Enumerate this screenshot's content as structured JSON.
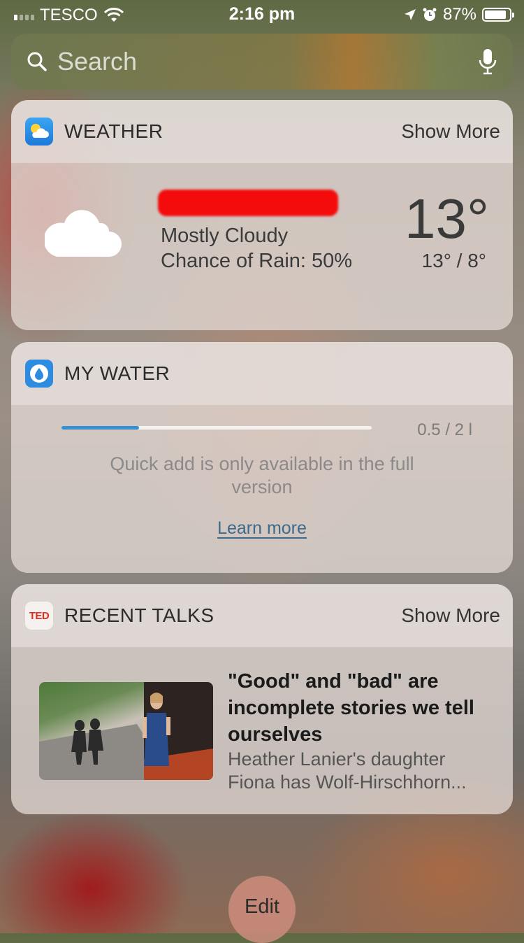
{
  "status_bar": {
    "carrier": "TESCO",
    "time": "2:16 pm",
    "battery": "87%",
    "battery_level": 0.87,
    "icons": [
      "signal-icon",
      "wifi-icon",
      "location-icon",
      "alarm-icon",
      "battery-icon"
    ]
  },
  "search": {
    "placeholder": "Search",
    "icons": [
      "search-icon",
      "microphone-icon"
    ]
  },
  "weather": {
    "title": "WEATHER",
    "show_more": "Show More",
    "condition": "Mostly Cloudy",
    "rain": "Chance of Rain: 50%",
    "temperature": "13°",
    "range": "13° / 8°",
    "icon": "cloud-icon"
  },
  "water": {
    "title": "MY WATER",
    "amount": "0.5 / 2 l",
    "progress": 0.25,
    "quick_add": "Quick add is only available in the full version",
    "learn_more": "Learn more",
    "accent": "#3a8fd0"
  },
  "talks": {
    "title": "RECENT TALKS",
    "show_more": "Show More",
    "talk_title": "\"Good\" and \"bad\" are incomplete stories we tell ourselves",
    "talk_desc": "Heather Lanier's daughter Fiona has Wolf-Hirschhorn...",
    "logo": "TED",
    "logo_color": "#e62b1e"
  },
  "edit": {
    "label": "Edit"
  }
}
